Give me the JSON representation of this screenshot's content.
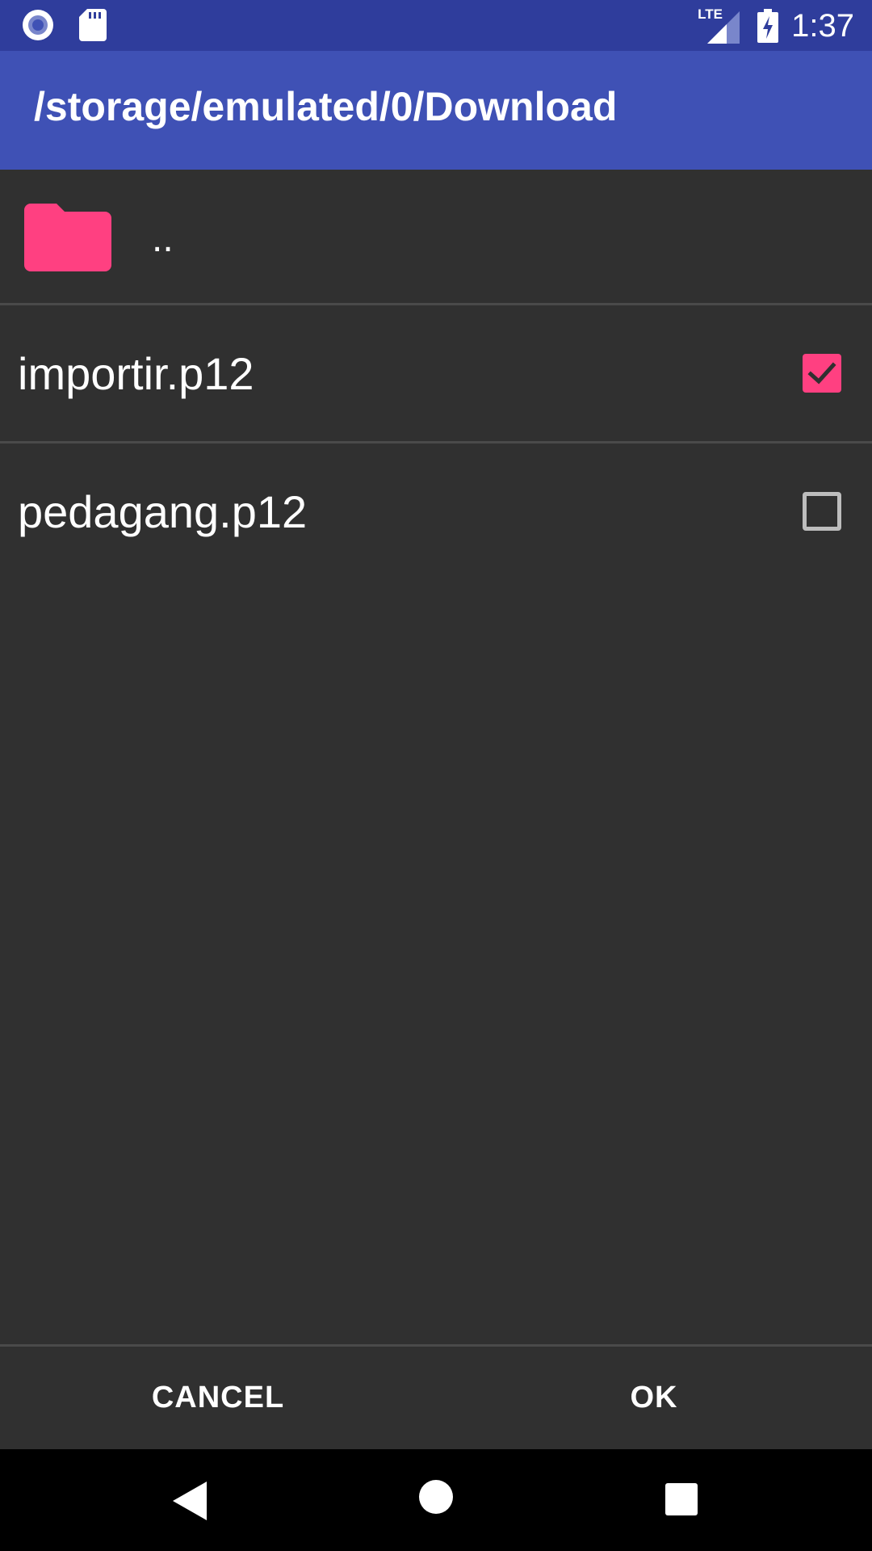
{
  "status_bar": {
    "time": "1:37",
    "network": "LTE",
    "icons": [
      "record-icon",
      "sd-card-icon",
      "lte-signal-icon",
      "battery-charging-icon"
    ]
  },
  "app_bar": {
    "title": "/storage/emulated/0/Download"
  },
  "list": {
    "parent_dir_label": "..",
    "files": [
      {
        "name": "importir.p12",
        "checked": true
      },
      {
        "name": "pedagang.p12",
        "checked": false
      }
    ]
  },
  "dialog": {
    "cancel_label": "CANCEL",
    "ok_label": "OK"
  },
  "colors": {
    "status_bar": "#2f3d9c",
    "app_bar": "#3f51b5",
    "background": "#303030",
    "accent": "#ff4081",
    "divider": "#4a4a4a"
  }
}
